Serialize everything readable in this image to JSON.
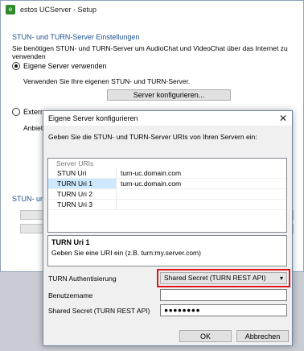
{
  "main": {
    "title": "estos UCServer - Setup",
    "section_title": "STUN- und TURN-Server Einstellungen",
    "section_desc": "Sie benötigen STUN- und TURN-Server um AudioChat und VideoChat über das Internet zu verwenden",
    "radio_own": "Eigene Server verwenden",
    "radio_own_desc": "Verwenden Sie Ihre eigenen STUN- und TURN-Server.",
    "configure_button": "Server konfigurieren...",
    "radio_external": "Externe",
    "external_desc": "Anbiete",
    "section_title_2": "STUN- und"
  },
  "dialog": {
    "title": "Eigene Server konfigurieren",
    "instruction": "Geben Sie die STUN- und TURN-Server URIs von Ihren Servern ein:",
    "table_header": "Server URIs",
    "rows": [
      {
        "name": "STUN Uri",
        "value": "turn-uc.domain.com"
      },
      {
        "name": "TURN Uri 1",
        "value": "turn-uc.domain.com"
      },
      {
        "name": "TURN Uri 2",
        "value": ""
      },
      {
        "name": "TURN Uri 3",
        "value": ""
      }
    ],
    "info_title": "TURN Uri 1",
    "info_text": "Geben Sie eine URI ein (z.B. turn:my.server.com)",
    "auth_label": "TURN Authentisierung",
    "auth_value": "Shared Secret (TURN REST API)",
    "username_label": "Benutzername",
    "username_value": "",
    "secret_label": "Shared Secret (TURN REST API)",
    "secret_value": "●●●●●●●●",
    "ok_button": "OK",
    "cancel_button": "Abbrechen"
  },
  "colors": {
    "highlight_border": "#e0161b",
    "selected_row": "#cde8ff",
    "section_title": "#1d4f8c"
  },
  "icons": {
    "app": "app-icon",
    "close": "close-icon",
    "dropdown": "chevron-down-icon"
  }
}
